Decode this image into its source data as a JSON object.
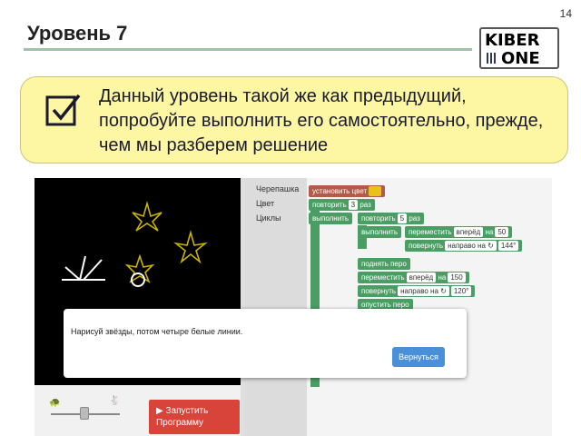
{
  "slide": {
    "number": "14",
    "title": "Уровень 7"
  },
  "logo": {
    "line1": "KIBER",
    "line2": "ONE"
  },
  "banner": {
    "text": "Данный уровень такой же как предыдущий, попробуйте выполнить его самостоятельно, прежде, чем мы разберем решение"
  },
  "toolbox": {
    "categories": [
      "Черепашка",
      "Цвет",
      "Циклы"
    ]
  },
  "blocks": {
    "set_color": "установить цвет",
    "repeat_outer": "повторить",
    "repeat_outer_count": "3",
    "times": "раз",
    "do": "выполнить",
    "repeat_inner": "повторить",
    "repeat_inner_count": "5",
    "times2": "раз",
    "do2": "выполнить",
    "move": "переместить",
    "forward": "вперёд",
    "on": "на",
    "move_value": "50",
    "turn": "повернуть",
    "turn_dir": "направо на ↻",
    "turn_value": "144°",
    "pen_up": "поднять",
    "pen": "перо",
    "move2": "переместить",
    "forward2": "вперёд",
    "on2": "на",
    "move2_value": "150",
    "turn2": "повернуть",
    "turn2_dir": "направо на ↻",
    "turn2_value": "120°",
    "pen_down": "опустить",
    "pen2": "перо"
  },
  "run_button": {
    "label": "▶ Запустить Программу"
  },
  "dialog": {
    "message": "Нарисуй звёзды, потом четыре белые линии.",
    "button": "Вернуться"
  },
  "colors": {
    "banner_bg": "#fdf7a3",
    "block_green": "#4a9e64",
    "run_red": "#d9443a",
    "dialog_btn": "#4a90d9",
    "star_yellow": "#c8b400"
  }
}
